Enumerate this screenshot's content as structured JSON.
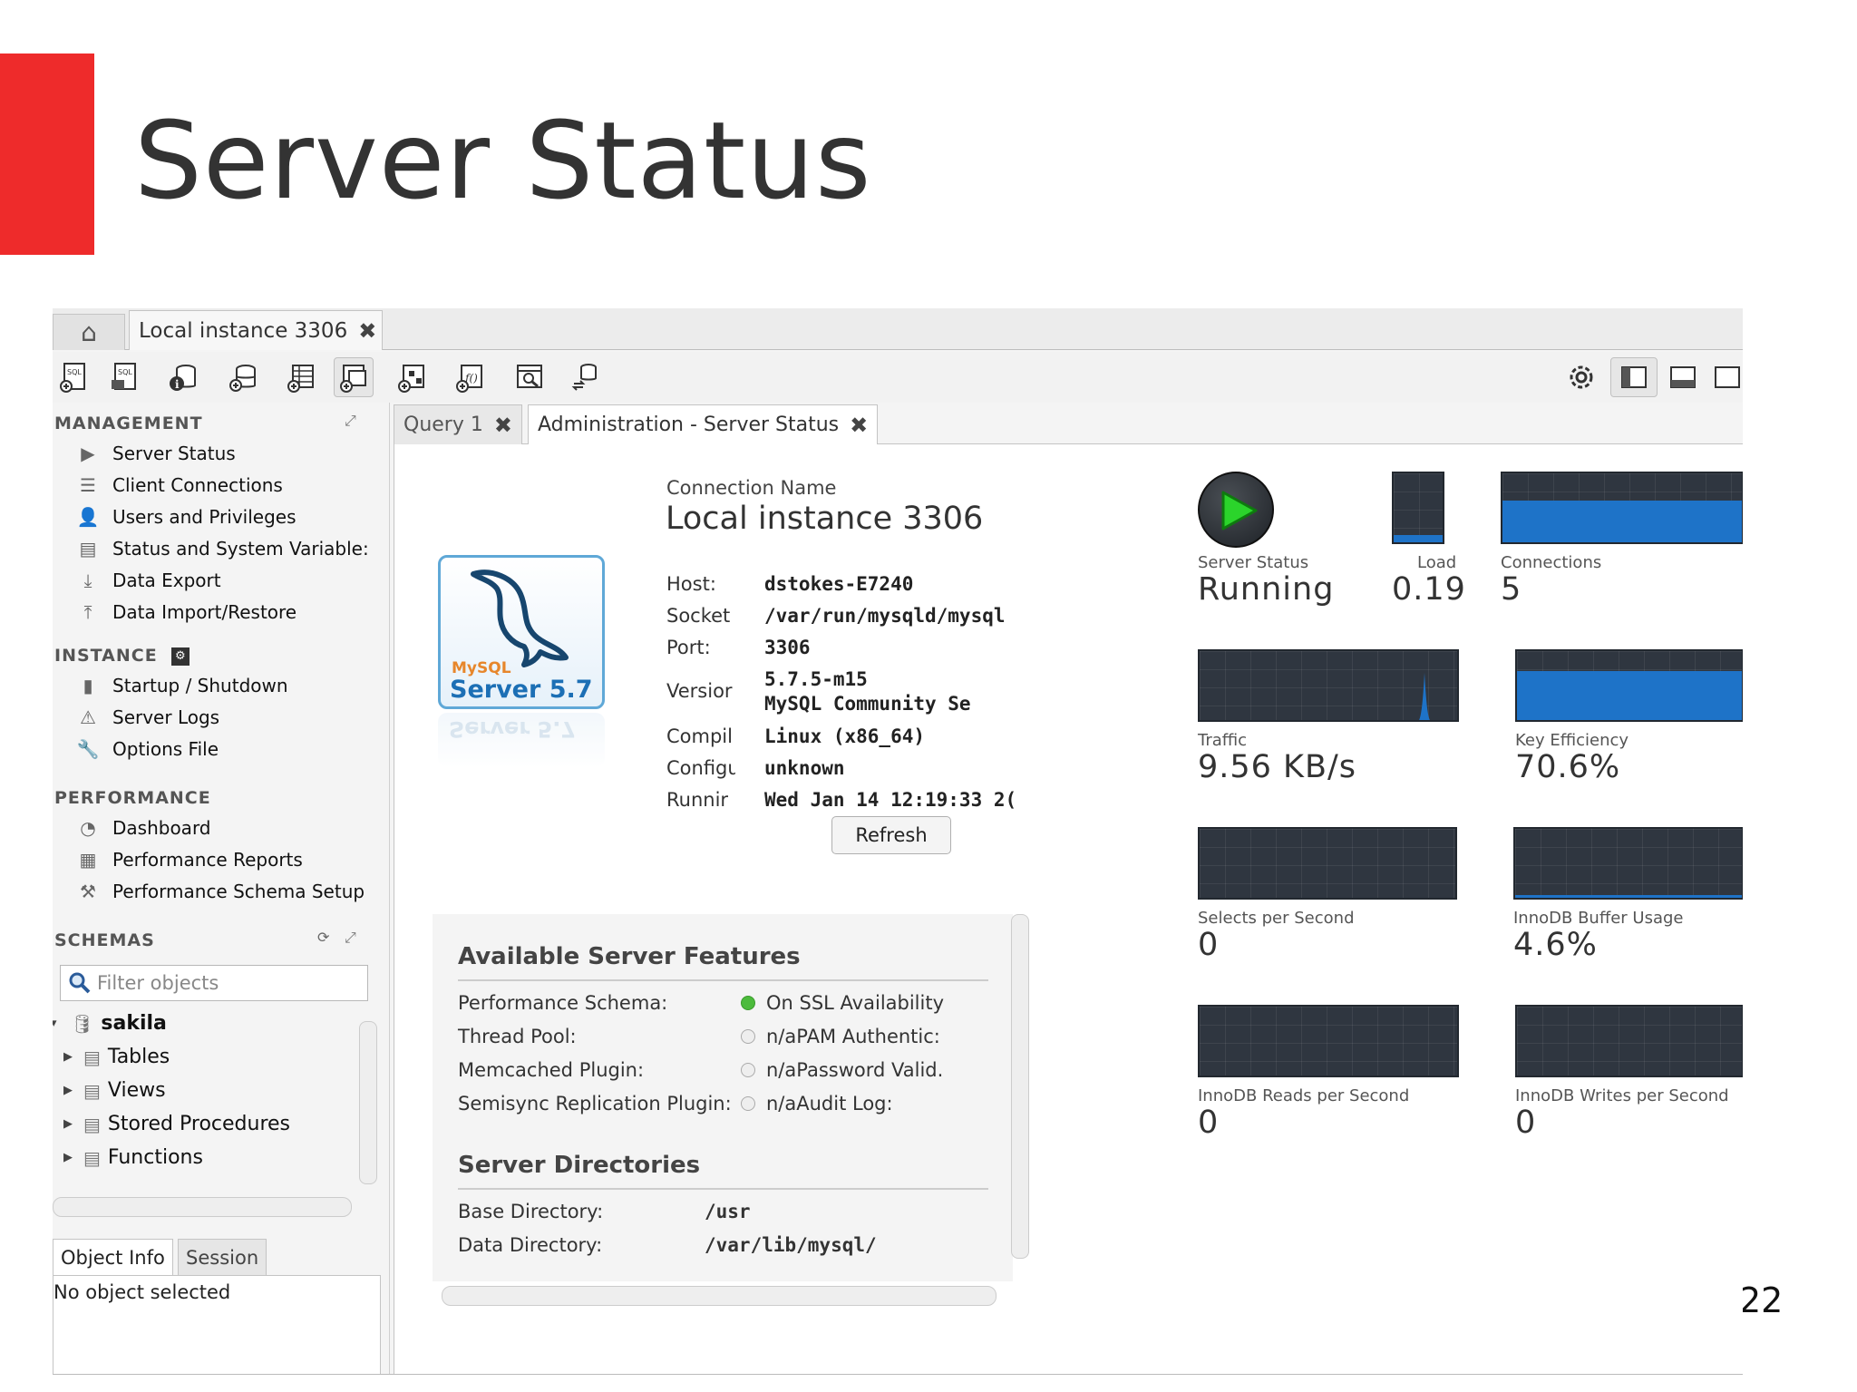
{
  "slide": {
    "title": "Server Status",
    "page_number": "22"
  },
  "colors": {
    "accent_red": "#ee2b2b",
    "graph_bg": "#2f3640",
    "graph_fill": "#1e73c8",
    "ssl_on": "#4cbb3c"
  },
  "window": {
    "tabs": {
      "home_icon": "home-icon",
      "instance_tab": "Local instance 3306"
    },
    "toolbar_icons": [
      "new-sql-tab-icon",
      "open-sql-script-icon",
      "inspector-icon",
      "create-schema-icon",
      "create-table-icon",
      "create-view-icon",
      "create-procedure-icon",
      "create-function-icon",
      "search-table-data-icon",
      "reconnect-icon",
      "settings-gear-icon",
      "toggle-sidebar-icon",
      "toggle-output-icon",
      "toggle-secondary-sidebar-icon"
    ]
  },
  "sidebar": {
    "management": {
      "header": "MANAGEMENT",
      "items": [
        {
          "label": "Server Status",
          "icon": "server-status-icon"
        },
        {
          "label": "Client Connections",
          "icon": "client-connections-icon"
        },
        {
          "label": "Users and Privileges",
          "icon": "user-icon"
        },
        {
          "label": "Status and System Variable:",
          "icon": "variables-icon"
        },
        {
          "label": "Data Export",
          "icon": "export-icon"
        },
        {
          "label": "Data Import/Restore",
          "icon": "import-icon"
        }
      ]
    },
    "instance": {
      "header": "INSTANCE",
      "items": [
        {
          "label": "Startup / Shutdown",
          "icon": "startup-icon"
        },
        {
          "label": "Server Logs",
          "icon": "warning-icon"
        },
        {
          "label": "Options File",
          "icon": "wrench-icon"
        }
      ]
    },
    "performance": {
      "header": "PERFORMANCE",
      "items": [
        {
          "label": "Dashboard",
          "icon": "dashboard-icon"
        },
        {
          "label": "Performance Reports",
          "icon": "reports-icon"
        },
        {
          "label": "Performance Schema Setup",
          "icon": "schema-setup-icon"
        }
      ]
    },
    "schemas": {
      "header": "SCHEMAS",
      "filter_placeholder": "Filter objects",
      "schema_name": "sakila",
      "children": [
        "Tables",
        "Views",
        "Stored Procedures",
        "Functions"
      ]
    },
    "bottom_tabs": {
      "object_info": "Object Info",
      "session": "Session"
    },
    "object_info_text": "No object selected"
  },
  "main": {
    "tabs": {
      "query": "Query 1",
      "admin": "Administration - Server Status"
    },
    "logo": {
      "brand": "MySQL",
      "product": "Server 5.7",
      "reflection": "Server 5.7"
    },
    "connection": {
      "name_label": "Connection Name",
      "name": "Local instance 3306",
      "rows": [
        {
          "label": "Host:",
          "value": "dstokes-E7240"
        },
        {
          "label": "Socket",
          "value": "/var/run/mysqld/mysql"
        },
        {
          "label": "Port:",
          "value": "3306"
        },
        {
          "label": "Versior",
          "value": "5.7.5-m15",
          "value2": "MySQL Community Se"
        },
        {
          "label": "Compil",
          "value": "Linux  (x86_64)"
        },
        {
          "label": "Configu",
          "value": "unknown"
        },
        {
          "label": "Runnir",
          "value": "Wed Jan 14 12:19:33 2("
        }
      ],
      "refresh_label": "Refresh"
    },
    "features": {
      "header": "Available Server Features",
      "rows": [
        {
          "label": "Performance Schema:",
          "status": "on",
          "value": "On SSL Availability"
        },
        {
          "label": "Thread Pool:",
          "status": "off",
          "value": "n/aPAM Authentic:"
        },
        {
          "label": "Memcached Plugin:",
          "status": "off",
          "value": "n/aPassword Valid."
        },
        {
          "label": "Semisync Replication Plugin:",
          "status": "off",
          "value": "n/aAudit Log:"
        }
      ],
      "dirs_header": "Server Directories",
      "dirs": [
        {
          "label": "Base Directory:",
          "value": "/usr"
        },
        {
          "label": "Data Directory:",
          "value": "/var/lib/mysql/"
        }
      ]
    },
    "stats": {
      "server_status": {
        "label": "Server Status",
        "value": "Running"
      },
      "load": {
        "label": "Load",
        "value": "0.19",
        "level": 0.1
      },
      "connections": {
        "label": "Connections",
        "value": "5",
        "level": 0.6
      },
      "traffic": {
        "label": "Traffic",
        "value": "9.56 KB/s"
      },
      "key_efficiency": {
        "label": "Key Efficiency",
        "value": "70.6%",
        "level": 0.706
      },
      "selects": {
        "label": "Selects per Second",
        "value": "0"
      },
      "innodb_buffer": {
        "label": "InnoDB Buffer Usage",
        "value": "4.6%",
        "level": 0.046
      },
      "innodb_reads": {
        "label": "InnoDB Reads per Second",
        "value": "0"
      },
      "innodb_writes": {
        "label": "InnoDB Writes per Second",
        "value": "0"
      }
    }
  }
}
